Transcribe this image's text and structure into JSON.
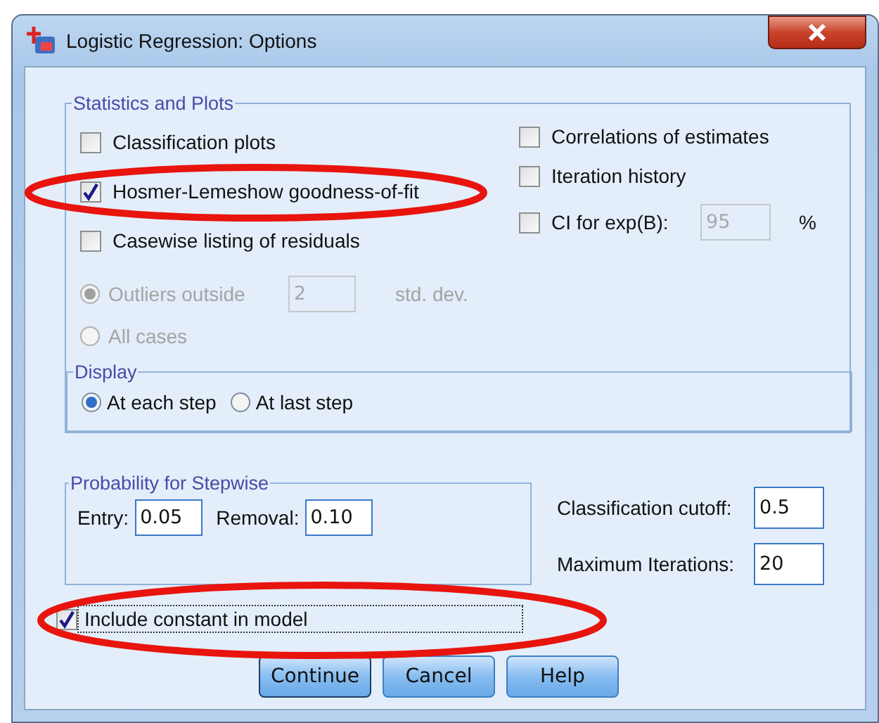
{
  "window": {
    "title": "Logistic Regression: Options"
  },
  "statistics": {
    "title": "Statistics and Plots",
    "left": [
      {
        "label": "Classification plots",
        "checked": false,
        "circled": false
      },
      {
        "label": "Hosmer-Lemeshow goodness-of-fit",
        "checked": true,
        "circled": true
      },
      {
        "label": "Casewise listing of residuals",
        "checked": false,
        "circled": false
      }
    ],
    "right": [
      {
        "label": "Correlations of estimates",
        "checked": false
      },
      {
        "label": "Iteration history",
        "checked": false
      },
      {
        "label": "CI for exp(B):",
        "checked": false
      }
    ],
    "ci_value": "95",
    "ci_unit": "%",
    "residual_options": [
      {
        "label": "Outliers outside",
        "selected": true,
        "disabled": true,
        "value": "2",
        "unit": "std. dev."
      },
      {
        "label": "All cases",
        "selected": false,
        "disabled": true
      }
    ]
  },
  "display": {
    "title": "Display",
    "options": [
      {
        "label": "At each step",
        "selected": true
      },
      {
        "label": "At last step",
        "selected": false
      }
    ]
  },
  "stepwise": {
    "title": "Probability for Stepwise",
    "fields": [
      {
        "label": "Entry:",
        "value": "0.05"
      },
      {
        "label": "Removal:",
        "value": "0.10"
      }
    ]
  },
  "settings": [
    {
      "label": "Classification cutoff:",
      "value": "0.5"
    },
    {
      "label": "Maximum Iterations:",
      "value": "20"
    }
  ],
  "include_constant": {
    "label": "Include constant in model",
    "checked": true,
    "circled": true
  },
  "buttons": [
    {
      "label": "Continue",
      "default": true
    },
    {
      "label": "Cancel",
      "default": false
    },
    {
      "label": "Help",
      "default": false
    }
  ]
}
